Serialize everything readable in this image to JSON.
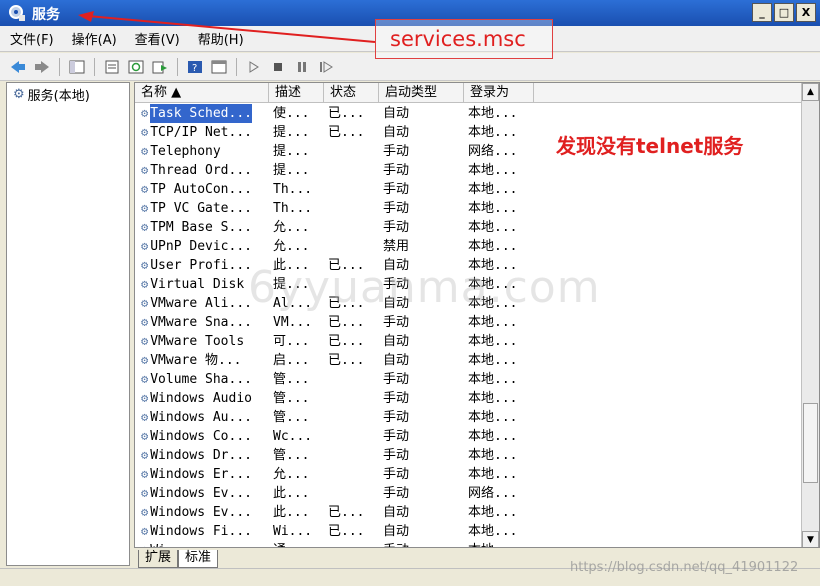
{
  "window": {
    "title": "服务",
    "min_label": "_",
    "max_label": "□",
    "close_label": "X"
  },
  "menu": [
    "文件(F)",
    "操作(A)",
    "查看(V)",
    "帮助(H)"
  ],
  "tree": {
    "root_label": "服务(本地)"
  },
  "columns": [
    "名称 ▲",
    "描述",
    "状态",
    "启动类型",
    "登录为"
  ],
  "rows": [
    [
      "Task Sched...",
      "使...",
      "已...",
      "自动",
      "本地..."
    ],
    [
      "TCP/IP Net...",
      "提...",
      "已...",
      "自动",
      "本地..."
    ],
    [
      "Telephony",
      "提...",
      "",
      "手动",
      "网络..."
    ],
    [
      "Thread Ord...",
      "提...",
      "",
      "手动",
      "本地..."
    ],
    [
      "TP AutoCon...",
      "Th...",
      "",
      "手动",
      "本地..."
    ],
    [
      "TP VC Gate...",
      "Th...",
      "",
      "手动",
      "本地..."
    ],
    [
      "TPM Base S...",
      "允...",
      "",
      "手动",
      "本地..."
    ],
    [
      "UPnP Devic...",
      "允...",
      "",
      "禁用",
      "本地..."
    ],
    [
      "User Profi...",
      "此...",
      "已...",
      "自动",
      "本地..."
    ],
    [
      "Virtual Disk",
      "提...",
      "",
      "手动",
      "本地..."
    ],
    [
      "VMware Ali...",
      "Al...",
      "已...",
      "自动",
      "本地..."
    ],
    [
      "VMware Sna...",
      "VM...",
      "已...",
      "手动",
      "本地..."
    ],
    [
      "VMware Tools",
      "可...",
      "已...",
      "自动",
      "本地..."
    ],
    [
      "VMware 物...",
      "启...",
      "已...",
      "自动",
      "本地..."
    ],
    [
      "Volume Sha...",
      "管...",
      "",
      "手动",
      "本地..."
    ],
    [
      "Windows Audio",
      "管...",
      "",
      "手动",
      "本地..."
    ],
    [
      "Windows Au...",
      "管...",
      "",
      "手动",
      "本地..."
    ],
    [
      "Windows Co...",
      "Wc...",
      "",
      "手动",
      "本地..."
    ],
    [
      "Windows Dr...",
      "管...",
      "",
      "手动",
      "本地..."
    ],
    [
      "Windows Er...",
      "允...",
      "",
      "手动",
      "本地..."
    ],
    [
      "Windows Ev...",
      "此...",
      "",
      "手动",
      "网络..."
    ],
    [
      "Windows Ev...",
      "此...",
      "已...",
      "自动",
      "本地..."
    ],
    [
      "Windows Fi...",
      "Wi...",
      "已...",
      "自动",
      "本地..."
    ],
    [
      "Wi...",
      "通...",
      "",
      "手动",
      "本地..."
    ]
  ],
  "tabs": [
    "扩展",
    "标准"
  ],
  "annotations": {
    "command": "services.msc",
    "note": "发现没有telnet服务"
  },
  "watermark": "6yyuanma.com",
  "credit": "https://blog.csdn.net/qq_41901122",
  "icons": [
    "back-icon",
    "forward-icon",
    "console-tree-icon",
    "properties-icon",
    "refresh-icon",
    "export-icon",
    "help-icon",
    "view-icon",
    "start-icon",
    "stop-icon",
    "pause-icon",
    "resume-icon"
  ],
  "colors": {
    "titlebar": "#1a4fb0",
    "selection": "#3366cc",
    "annotation": "#e02020"
  }
}
